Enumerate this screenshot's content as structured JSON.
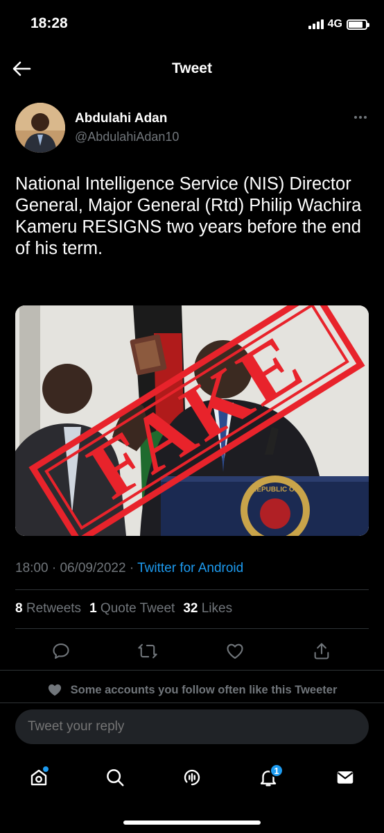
{
  "status_bar": {
    "time": "18:28",
    "network": "4G",
    "battery_level": 0.85
  },
  "header": {
    "title": "Tweet"
  },
  "tweet": {
    "author_name": "Abdulahi Adan",
    "author_handle": "@AbdulahiAdan10",
    "text": "National Intelligence Service (NIS) Director General, Major General (Rtd) Philip Wachira Kameru RESIGNS two years before the end of his term.",
    "stamp_text": "FAKE",
    "seal_text": "REPUBLIC OF",
    "time": "18:00",
    "date": "06/09/2022",
    "separator": "·",
    "source": "Twitter for Android"
  },
  "stats": {
    "retweets_count": "8",
    "retweets_label": "Retweets",
    "quotes_count": "1",
    "quotes_label": "Quote Tweet",
    "likes_count": "32",
    "likes_label": "Likes"
  },
  "social_context": "Some accounts you follow often like this Tweeter",
  "reply": {
    "placeholder": "Tweet your reply"
  },
  "nav": {
    "notifications_badge": "1"
  },
  "colors": {
    "accent": "#1d9bf0",
    "background": "#000000",
    "muted": "#71767b",
    "stamp": "#e8232b"
  },
  "icons": [
    "back-arrow-icon",
    "more-icon",
    "reply-icon",
    "retweet-icon",
    "like-icon",
    "share-icon",
    "heart-icon",
    "home-icon",
    "search-icon",
    "spaces-icon",
    "bell-icon",
    "mail-icon"
  ]
}
